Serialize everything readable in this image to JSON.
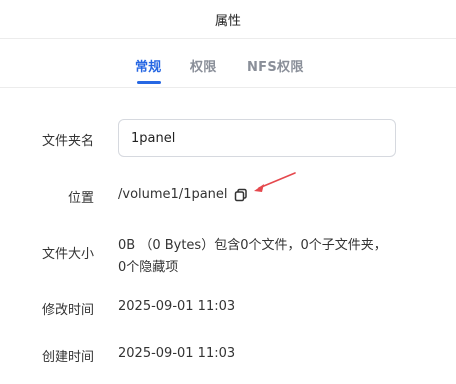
{
  "dialog": {
    "title": "属性"
  },
  "tabs": [
    {
      "label": "常规",
      "active": true
    },
    {
      "label": "权限",
      "active": false
    },
    {
      "label": "NFS权限",
      "active": false
    }
  ],
  "fields": {
    "name": {
      "label": "文件夹名",
      "value": "1panel"
    },
    "location": {
      "label": "位置",
      "value": "/volume1/1panel",
      "icon": "copy-icon"
    },
    "size": {
      "label": "文件大小",
      "line1": "0B （0 Bytes）包含0个文件，0个子文件夹，",
      "line2": "0个隐藏项"
    },
    "modified": {
      "label": "修改时间",
      "value": "2025-09-01 11:03"
    },
    "created": {
      "label": "创建时间",
      "value": "2025-09-01 11:03"
    }
  },
  "colors": {
    "accent": "#2667e3",
    "annotation_arrow": "#e5484d"
  }
}
